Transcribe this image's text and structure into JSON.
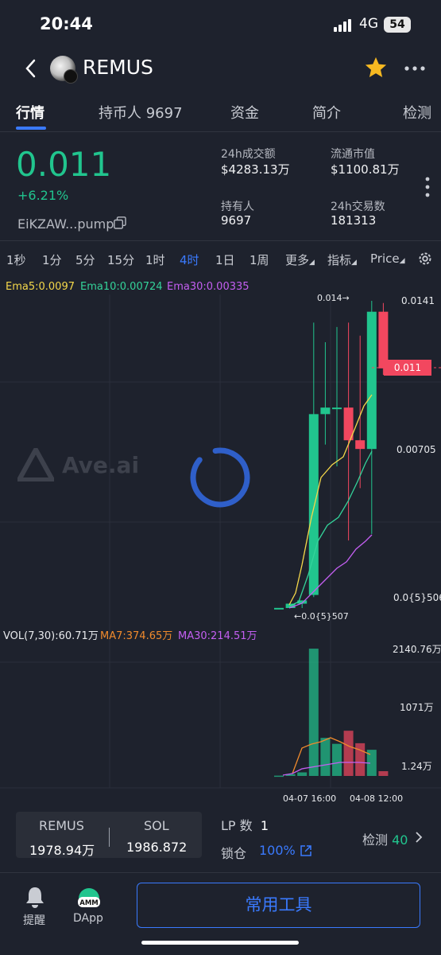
{
  "status": {
    "time": "20:44",
    "network": "4G",
    "battery": "54"
  },
  "header": {
    "title": "REMUS"
  },
  "tabs": [
    {
      "label": "行情",
      "active": true
    },
    {
      "label": "持币人 9697"
    },
    {
      "label": "资金"
    },
    {
      "label": "简介"
    },
    {
      "label": "检测"
    }
  ],
  "token": {
    "price": "0.011",
    "change": "+6.21%",
    "address": "EiKZAW...pump",
    "stats": {
      "volume_label": "24h成交额",
      "volume_value": "$4283.13万",
      "mcap_label": "流通市值",
      "mcap_value": "$1100.81万",
      "holders_label": "持有人",
      "holders_value": "9697",
      "tx_label": "24h交易数",
      "tx_value": "181313"
    }
  },
  "intervals": [
    "1秒",
    "1分",
    "5分",
    "15分",
    "1时",
    "4时",
    "1日",
    "1周",
    "更多",
    "指标",
    "Price"
  ],
  "active_interval": "4时",
  "indicators": {
    "ema5": "Ema5:0.0097",
    "ema10": "Ema10:0.00724",
    "ema30": "Ema30:0.00335",
    "vol": "VOL(7,30):60.71万",
    "ma7": "MA7:374.65万",
    "ma30": "MA30:214.51万"
  },
  "colors": {
    "up": "#21c58e",
    "down": "#f2475f",
    "accent": "#3a7afe",
    "ema5": "#f5d84a",
    "ema10": "#34d39a",
    "ema30": "#c45ff2",
    "ma7": "#f08a2c",
    "ma30": "#c45ff2"
  },
  "watermark": "Ave.ai",
  "chart_data": {
    "type": "candlestick",
    "price_axis": [
      "0.0141",
      "0.00705",
      "0.0{5}506"
    ],
    "current_price_tag": "0.011",
    "high_annotation": "0.014→",
    "low_annotation": "←0.0{5}507",
    "volume_axis": [
      "2140.76万",
      "1071万",
      "1.24万"
    ],
    "x_labels": [
      "04-07 16:00",
      "04-08 12:00"
    ],
    "candles": [
      {
        "o": 5e-06,
        "h": 6e-06,
        "l": 5e-06,
        "c": 6e-06,
        "vol": 5
      },
      {
        "o": 0.0,
        "h": 0.0002,
        "l": 0.0,
        "c": 0.0002,
        "vol": 30
      },
      {
        "o": 0.0002,
        "h": 0.00035,
        "l": 0.0,
        "c": 0.00035,
        "vol": 60
      },
      {
        "o": 0.0006,
        "h": 0.0131,
        "l": 0.0005,
        "c": 0.0089,
        "vol": 2140
      },
      {
        "o": 0.0089,
        "h": 0.0122,
        "l": 0.0075,
        "c": 0.0092,
        "vol": 640
      },
      {
        "o": 0.0092,
        "h": 0.0129,
        "l": 0.0065,
        "c": 0.0092,
        "vol": 540
      },
      {
        "o": 0.0092,
        "h": 0.0131,
        "l": 0.0031,
        "c": 0.0077,
        "vol": 760
      },
      {
        "o": 0.0077,
        "h": 0.0125,
        "l": 0.0055,
        "c": 0.0073,
        "vol": 550
      },
      {
        "o": 0.0073,
        "h": 0.0141,
        "l": 0.0034,
        "c": 0.0136,
        "vol": 440
      },
      {
        "o": 0.0136,
        "h": 0.014,
        "l": 0.0107,
        "c": 0.011,
        "vol": 80
      }
    ]
  },
  "bottom": {
    "token_a": "REMUS",
    "token_a_val": "1978.94万",
    "token_b": "SOL",
    "token_b_val": "1986.872",
    "lp_label": "LP 数",
    "lp_val": "1",
    "lock_label": "锁仓",
    "lock_val": "100%",
    "check_label": "检测",
    "check_val": "40"
  },
  "footer": {
    "alert": "提醒",
    "dapp": "DApp",
    "amm": "AMM",
    "tools": "常用工具"
  }
}
